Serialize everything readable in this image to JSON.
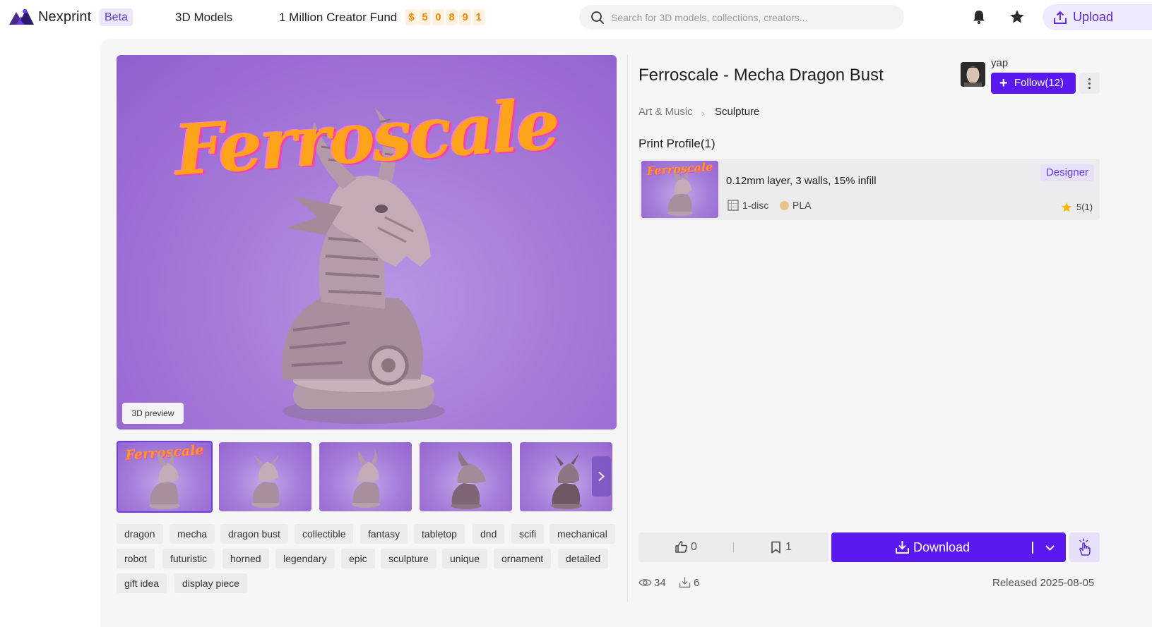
{
  "header": {
    "brand": "Nexprint",
    "beta": "Beta",
    "nav_models": "3D Models",
    "nav_fund": "1 Million Creator Fund",
    "fund_digits": [
      "$",
      "5",
      "0",
      "8",
      "9",
      "1"
    ],
    "search_placeholder": "Search for 3D models, collections, creators...",
    "upload": "Upload",
    "icons": [
      "logo-icon",
      "search-icon",
      "bell-icon",
      "star-icon",
      "upload-icon"
    ]
  },
  "gallery": {
    "hero_text": "Ferroscale",
    "preview_button": "3D preview",
    "thumbnails": [
      "thumbnail-1",
      "thumbnail-2",
      "thumbnail-3",
      "thumbnail-4",
      "thumbnail-5"
    ],
    "active_thumbnail": 0,
    "thumb_text": "Ferroscale"
  },
  "tags": [
    "dragon",
    "mecha",
    "dragon bust",
    "collectible",
    "fantasy",
    "tabletop",
    "dnd",
    "scifi",
    "mechanical",
    "robot",
    "futuristic",
    "horned",
    "legendary",
    "epic",
    "sculpture",
    "unique",
    "ornament",
    "detailed",
    "gift idea",
    "display piece"
  ],
  "model": {
    "title": "Ferroscale - Mecha Dragon Bust",
    "creator": "yap",
    "follow": "Follow(12)",
    "breadcrumb": [
      "Art & Music",
      "Sculpture"
    ]
  },
  "print_profiles": {
    "heading": "Print Profile(1)",
    "items": [
      {
        "description": "0.12mm layer, 3 walls, 15% infill",
        "plates": "1-disc",
        "material": "PLA",
        "material_color": "#e8c48a",
        "badge": "Designer",
        "rating": "5(1)",
        "thumb_text": "Ferroscale"
      }
    ]
  },
  "actions": {
    "likes": "0",
    "bookmarks": "1",
    "download": "Download",
    "views": "34",
    "downloads": "6",
    "released": "Released 2025-08-05"
  },
  "colors": {
    "accent": "#5a19f0",
    "fund_orange": "#f08a00",
    "rating_star": "#f5b800"
  }
}
